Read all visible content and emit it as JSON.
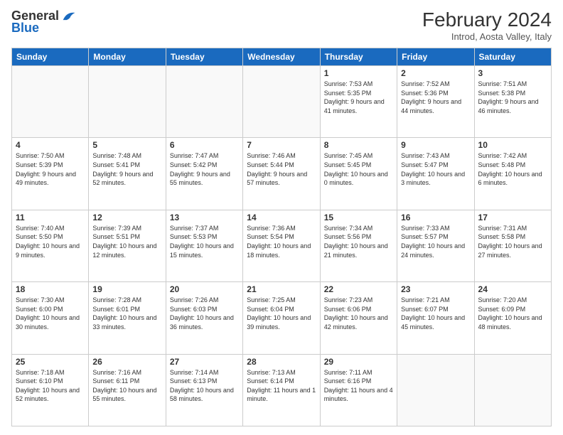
{
  "logo": {
    "text_general": "General",
    "text_blue": "Blue"
  },
  "header": {
    "title": "February 2024",
    "subtitle": "Introd, Aosta Valley, Italy"
  },
  "weekdays": [
    "Sunday",
    "Monday",
    "Tuesday",
    "Wednesday",
    "Thursday",
    "Friday",
    "Saturday"
  ],
  "weeks": [
    [
      {
        "day": "",
        "info": ""
      },
      {
        "day": "",
        "info": ""
      },
      {
        "day": "",
        "info": ""
      },
      {
        "day": "",
        "info": ""
      },
      {
        "day": "1",
        "info": "Sunrise: 7:53 AM\nSunset: 5:35 PM\nDaylight: 9 hours and 41 minutes."
      },
      {
        "day": "2",
        "info": "Sunrise: 7:52 AM\nSunset: 5:36 PM\nDaylight: 9 hours and 44 minutes."
      },
      {
        "day": "3",
        "info": "Sunrise: 7:51 AM\nSunset: 5:38 PM\nDaylight: 9 hours and 46 minutes."
      }
    ],
    [
      {
        "day": "4",
        "info": "Sunrise: 7:50 AM\nSunset: 5:39 PM\nDaylight: 9 hours and 49 minutes."
      },
      {
        "day": "5",
        "info": "Sunrise: 7:48 AM\nSunset: 5:41 PM\nDaylight: 9 hours and 52 minutes."
      },
      {
        "day": "6",
        "info": "Sunrise: 7:47 AM\nSunset: 5:42 PM\nDaylight: 9 hours and 55 minutes."
      },
      {
        "day": "7",
        "info": "Sunrise: 7:46 AM\nSunset: 5:44 PM\nDaylight: 9 hours and 57 minutes."
      },
      {
        "day": "8",
        "info": "Sunrise: 7:45 AM\nSunset: 5:45 PM\nDaylight: 10 hours and 0 minutes."
      },
      {
        "day": "9",
        "info": "Sunrise: 7:43 AM\nSunset: 5:47 PM\nDaylight: 10 hours and 3 minutes."
      },
      {
        "day": "10",
        "info": "Sunrise: 7:42 AM\nSunset: 5:48 PM\nDaylight: 10 hours and 6 minutes."
      }
    ],
    [
      {
        "day": "11",
        "info": "Sunrise: 7:40 AM\nSunset: 5:50 PM\nDaylight: 10 hours and 9 minutes."
      },
      {
        "day": "12",
        "info": "Sunrise: 7:39 AM\nSunset: 5:51 PM\nDaylight: 10 hours and 12 minutes."
      },
      {
        "day": "13",
        "info": "Sunrise: 7:37 AM\nSunset: 5:53 PM\nDaylight: 10 hours and 15 minutes."
      },
      {
        "day": "14",
        "info": "Sunrise: 7:36 AM\nSunset: 5:54 PM\nDaylight: 10 hours and 18 minutes."
      },
      {
        "day": "15",
        "info": "Sunrise: 7:34 AM\nSunset: 5:56 PM\nDaylight: 10 hours and 21 minutes."
      },
      {
        "day": "16",
        "info": "Sunrise: 7:33 AM\nSunset: 5:57 PM\nDaylight: 10 hours and 24 minutes."
      },
      {
        "day": "17",
        "info": "Sunrise: 7:31 AM\nSunset: 5:58 PM\nDaylight: 10 hours and 27 minutes."
      }
    ],
    [
      {
        "day": "18",
        "info": "Sunrise: 7:30 AM\nSunset: 6:00 PM\nDaylight: 10 hours and 30 minutes."
      },
      {
        "day": "19",
        "info": "Sunrise: 7:28 AM\nSunset: 6:01 PM\nDaylight: 10 hours and 33 minutes."
      },
      {
        "day": "20",
        "info": "Sunrise: 7:26 AM\nSunset: 6:03 PM\nDaylight: 10 hours and 36 minutes."
      },
      {
        "day": "21",
        "info": "Sunrise: 7:25 AM\nSunset: 6:04 PM\nDaylight: 10 hours and 39 minutes."
      },
      {
        "day": "22",
        "info": "Sunrise: 7:23 AM\nSunset: 6:06 PM\nDaylight: 10 hours and 42 minutes."
      },
      {
        "day": "23",
        "info": "Sunrise: 7:21 AM\nSunset: 6:07 PM\nDaylight: 10 hours and 45 minutes."
      },
      {
        "day": "24",
        "info": "Sunrise: 7:20 AM\nSunset: 6:09 PM\nDaylight: 10 hours and 48 minutes."
      }
    ],
    [
      {
        "day": "25",
        "info": "Sunrise: 7:18 AM\nSunset: 6:10 PM\nDaylight: 10 hours and 52 minutes."
      },
      {
        "day": "26",
        "info": "Sunrise: 7:16 AM\nSunset: 6:11 PM\nDaylight: 10 hours and 55 minutes."
      },
      {
        "day": "27",
        "info": "Sunrise: 7:14 AM\nSunset: 6:13 PM\nDaylight: 10 hours and 58 minutes."
      },
      {
        "day": "28",
        "info": "Sunrise: 7:13 AM\nSunset: 6:14 PM\nDaylight: 11 hours and 1 minute."
      },
      {
        "day": "29",
        "info": "Sunrise: 7:11 AM\nSunset: 6:16 PM\nDaylight: 11 hours and 4 minutes."
      },
      {
        "day": "",
        "info": ""
      },
      {
        "day": "",
        "info": ""
      }
    ]
  ]
}
